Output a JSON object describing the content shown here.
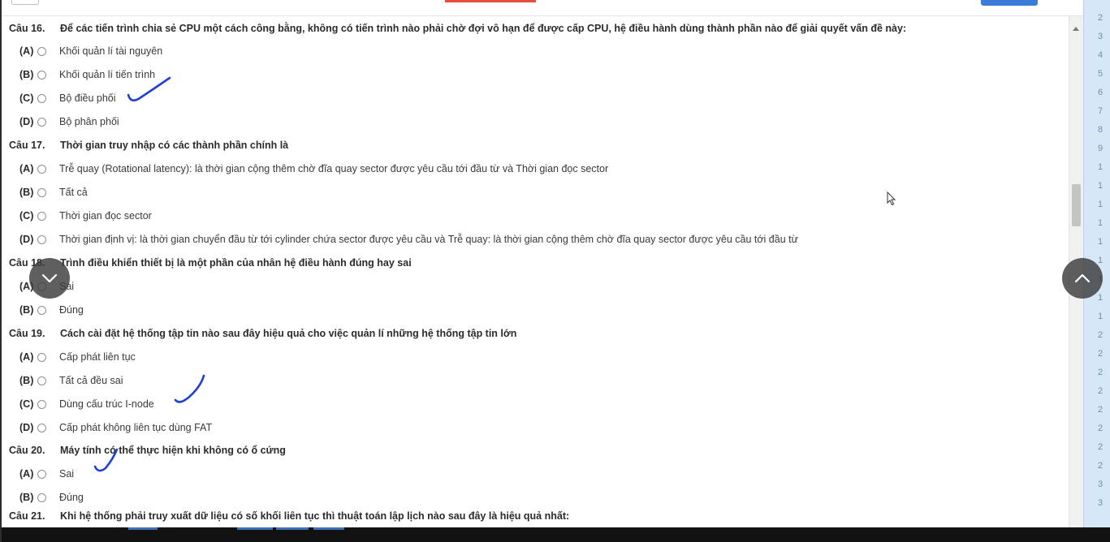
{
  "colors": {
    "ink": "#1f3fd6",
    "line_gutter": "#d6e7f7",
    "accent": "#3d7bd9"
  },
  "questions": [
    {
      "label": "Câu 16.",
      "text": "Để các tiến trình chia sẻ CPU một cách công bằng, không có tiến trình nào phải chờ đợi vô hạn để được cấp CPU, hệ điều hành dùng thành phần nào để giải quyết vấn đề này:",
      "options": [
        {
          "letter": "(A)",
          "text": "Khối quản lí tài nguyên"
        },
        {
          "letter": "(B)",
          "text": "Khối quản lí tiến trình"
        },
        {
          "letter": "(C)",
          "text": "Bộ điều phối"
        },
        {
          "letter": "(D)",
          "text": "Bộ phân phối"
        }
      ]
    },
    {
      "label": "Câu 17.",
      "text": "Thời gian truy nhập có các thành phần chính là",
      "options": [
        {
          "letter": "(A)",
          "text": "Trễ quay (Rotational latency): là thời gian cộng thêm chờ đĩa quay sector được yêu cầu tới đầu từ và Thời gian đọc sector"
        },
        {
          "letter": "(B)",
          "text": "Tất cả"
        },
        {
          "letter": "(C)",
          "text": "Thời gian đọc sector"
        },
        {
          "letter": "(D)",
          "text": "Thời gian định vị: là thời gian chuyển đầu từ tới cylinder chứa sector được yêu cầu và Trễ quay: là thời gian cộng thêm chờ đĩa quay sector được yêu cầu tới đầu từ"
        }
      ]
    },
    {
      "label": "Câu 18.",
      "text": "Trình điều khiển thiết bị là một phần của nhân hệ điều hành đúng hay sai",
      "options": [
        {
          "letter": "(A)",
          "text": "Sai"
        },
        {
          "letter": "(B)",
          "text": "Đúng"
        }
      ]
    },
    {
      "label": "Câu 19.",
      "text": "Cách cài đặt hệ thống tập tin nào sau đây hiệu quả cho việc quản lí những hệ thống tập tin lớn",
      "options": [
        {
          "letter": "(A)",
          "text": "Cấp phát liên tục"
        },
        {
          "letter": "(B)",
          "text": "Tất cả đều sai"
        },
        {
          "letter": "(C)",
          "text": "Dùng cấu trúc I-node"
        },
        {
          "letter": "(D)",
          "text": "Cấp phát không liên tục dùng FAT"
        }
      ]
    },
    {
      "label": "Câu 20.",
      "text": "Máy tính có thể thực hiện khi không có ổ cứng",
      "options": [
        {
          "letter": "(A)",
          "text": "Sai"
        },
        {
          "letter": "(B)",
          "text": "Đúng"
        }
      ]
    },
    {
      "label": "Câu 21.",
      "text": "Khi hệ thống phải truy xuất dữ liệu có số khối liên tục thì thuật toán lập lịch nào sau đây là hiệu quả nhất:",
      "options": []
    }
  ],
  "line_numbers": [
    "2",
    "3",
    "4",
    "5",
    "6",
    "7",
    "8",
    "9",
    "1",
    "1",
    "1",
    "1",
    "1",
    "1",
    "1",
    "1",
    "1",
    "2",
    "2",
    "2",
    "2",
    "2",
    "2",
    "2",
    "2",
    "3",
    "3"
  ],
  "nav": {
    "prev_icon": "chevron-down-icon",
    "next_icon": "chevron-up-icon"
  }
}
